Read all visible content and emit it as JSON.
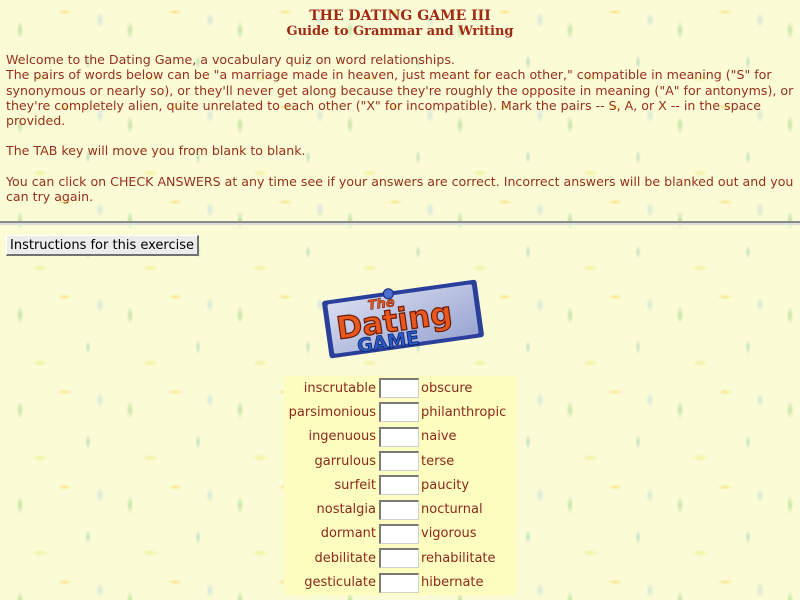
{
  "header": {
    "title": "THE DATING GAME III",
    "subtitle": "Guide to Grammar and Writing"
  },
  "intro": {
    "p1_line1": "Welcome to the Dating Game, a vocabulary quiz on word relationships.",
    "p1_line2": "The pairs of words below can be \"a marriage made in heaven, just meant for each other,\" compatible in meaning (\"S\" for synonymous or nearly so), or they'll never get along because they're roughly the opposite in meaning (\"A\" for antonyms), or they're completely alien, quite unrelated to each other (\"X\" for incompatible). Mark the pairs -- S, A, or X -- in the space provided.",
    "p2": "The TAB key will move you from blank to blank.",
    "p3": "You can click on CHECK ANSWERS at any time see if your answers are correct. Incorrect answers will be blanked out and you can try again."
  },
  "instructions_button": "Instructions for this exercise",
  "logo": {
    "top_word": "The",
    "mid_word": "Dating",
    "bottom_word": "GAME"
  },
  "colors": {
    "text": "#8b2a1a",
    "page_background": "#fbfbd6",
    "quiz_background": "#fdfdc0",
    "logo_frame": "#2a3f9a",
    "logo_word": "#e8571e"
  },
  "pairs": [
    {
      "left": "inscrutable",
      "right": "obscure",
      "answer": ""
    },
    {
      "left": "parsimonious",
      "right": "philanthropic",
      "answer": ""
    },
    {
      "left": "ingenuous",
      "right": "naive",
      "answer": ""
    },
    {
      "left": "garrulous",
      "right": "terse",
      "answer": ""
    },
    {
      "left": "surfeit",
      "right": "paucity",
      "answer": ""
    },
    {
      "left": "nostalgia",
      "right": "nocturnal",
      "answer": ""
    },
    {
      "left": "dormant",
      "right": "vigorous",
      "answer": ""
    },
    {
      "left": "debilitate",
      "right": "rehabilitate",
      "answer": ""
    },
    {
      "left": "gesticulate",
      "right": "hibernate",
      "answer": ""
    }
  ]
}
